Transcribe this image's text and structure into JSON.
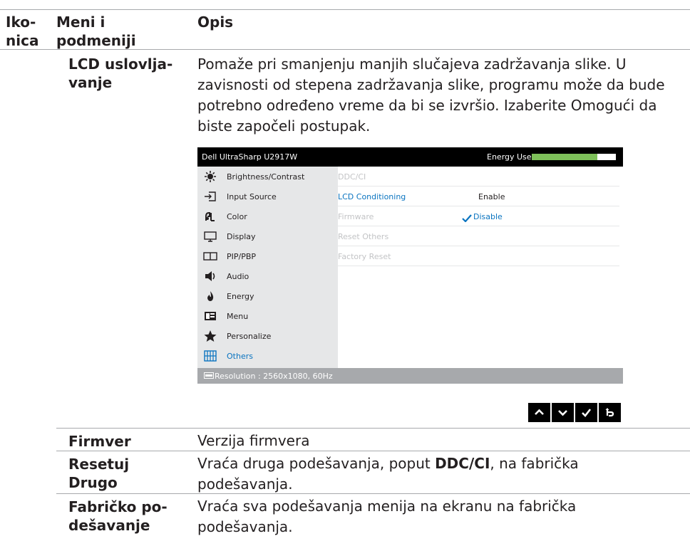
{
  "header": {
    "col_icon": "Iko-\nnica",
    "col_menu": "Meni i\npodmeniji",
    "col_desc": "Opis"
  },
  "lcd": {
    "label": "LCD uslovlja-\nvanje",
    "desc": "Pomaže pri smanjenju manjih slučajeva zadržavanja slike. U zavisnosti od stepena zadržavanja slike, programu može da bude potrebno određeno vreme da bi se izvršio. Izaberite Omogući da biste započeli postupak."
  },
  "osd": {
    "title": "Dell UltraSharp U2917W",
    "energy_label": "Energy Use",
    "energy_level": 0.78,
    "menu": [
      {
        "label": "Brightness/Contrast",
        "icon": "brightness-icon"
      },
      {
        "label": "Input Source",
        "icon": "input-source-icon"
      },
      {
        "label": "Color",
        "icon": "color-icon"
      },
      {
        "label": "Display",
        "icon": "display-icon"
      },
      {
        "label": "PIP/PBP",
        "icon": "pip-pbp-icon"
      },
      {
        "label": "Audio",
        "icon": "audio-icon"
      },
      {
        "label": "Energy",
        "icon": "energy-icon"
      },
      {
        "label": "Menu",
        "icon": "menu-icon"
      },
      {
        "label": "Personalize",
        "icon": "star-icon"
      },
      {
        "label": "Others",
        "icon": "others-icon"
      }
    ],
    "submenu": [
      "DDC/CI",
      "LCD Conditioning",
      "Firmware",
      "Reset Others",
      "Factory Reset"
    ],
    "option_enable": "Enable",
    "option_disable": "Disable",
    "status": "Resolution : 2560x1080, 60Hz",
    "accent_color": "#0a74c0",
    "energy_color": "#7ec05a"
  },
  "rows": [
    {
      "label": "Firmver",
      "desc": "Verzija firmvera"
    },
    {
      "label": "Resetuj\nDrugo",
      "desc_pre": "Vraća druga podešavanja, poput ",
      "desc_bold": "DDC/CI",
      "desc_post": ", na fabrička podešavanja."
    },
    {
      "label": "Fabričko po-\ndešavanje",
      "desc": "Vraća sva podešavanja menija na ekranu na fabrička podešavanja."
    }
  ],
  "nav_buttons": [
    "up-arrow-icon",
    "down-arrow-icon",
    "check-icon",
    "back-icon"
  ]
}
